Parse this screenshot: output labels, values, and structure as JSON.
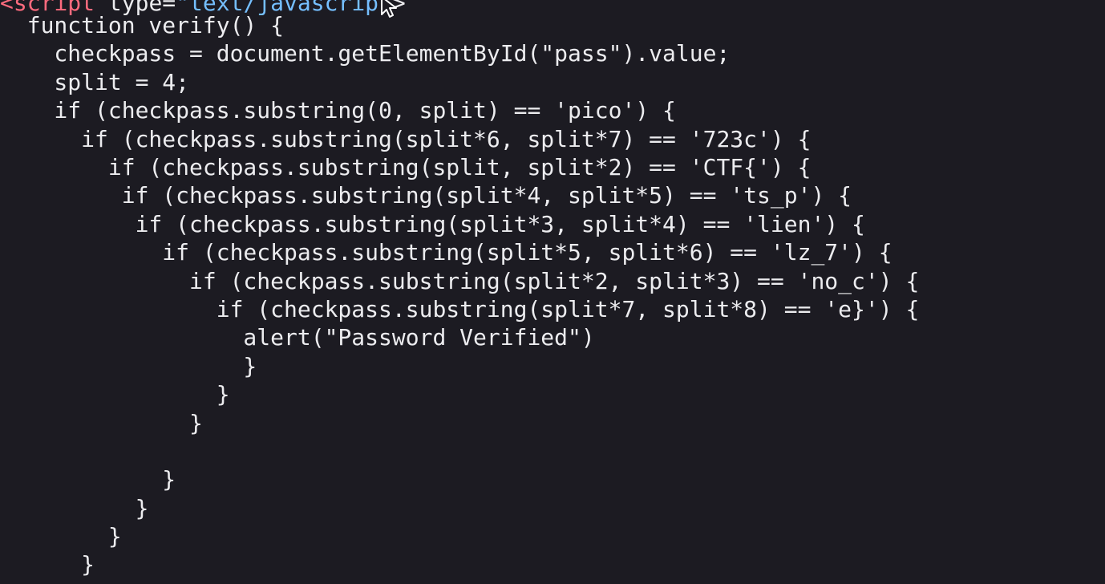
{
  "source_view": {
    "script_tag": {
      "open": "<",
      "name": "script",
      "attr": " type=",
      "value": "\"text/javascrip",
      "close": " >"
    },
    "lines": [
      "  function verify() {",
      "    checkpass = document.getElementById(\"pass\").value;",
      "    split = 4;",
      "    if (checkpass.substring(0, split) == 'pico') {",
      "      if (checkpass.substring(split*6, split*7) == '723c') {",
      "        if (checkpass.substring(split, split*2) == 'CTF{') {",
      "         if (checkpass.substring(split*4, split*5) == 'ts_p') {",
      "          if (checkpass.substring(split*3, split*4) == 'lien') {",
      "            if (checkpass.substring(split*5, split*6) == 'lz_7') {",
      "              if (checkpass.substring(split*2, split*3) == 'no_c') {",
      "                if (checkpass.substring(split*7, split*8) == 'e}') {",
      "                  alert(\"Password Verified\")",
      "                  }",
      "                }",
      "              }",
      "",
      "            }",
      "          }",
      "        }",
      "      }",
      "    }"
    ]
  },
  "colors": {
    "background": "#1c1b22",
    "text": "#ececef",
    "tag": "#ff6b7e",
    "attribute_value": "#75bfff"
  },
  "icons": {
    "cursor": "mouse-pointer-icon"
  }
}
